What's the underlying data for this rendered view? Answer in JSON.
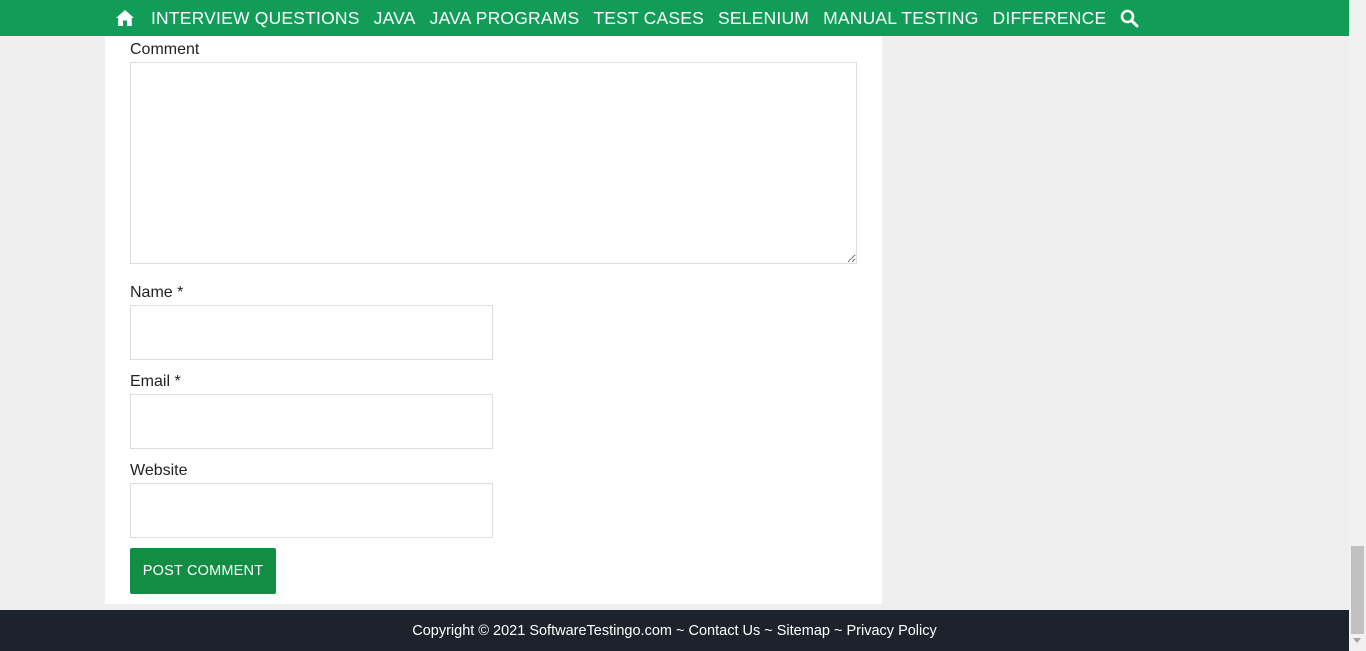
{
  "nav": {
    "items": [
      {
        "label": "INTERVIEW QUESTIONS"
      },
      {
        "label": "JAVA"
      },
      {
        "label": "JAVA PROGRAMS"
      },
      {
        "label": "TEST CASES"
      },
      {
        "label": "SELENIUM"
      },
      {
        "label": "MANUAL TESTING"
      },
      {
        "label": "DIFFERENCE"
      }
    ],
    "home_icon": "home-icon",
    "search_icon": "search-icon",
    "bg_color": "#119c57"
  },
  "form": {
    "comment_label": "Comment",
    "comment_value": "",
    "name_label": "Name *",
    "name_value": "",
    "email_label": "Email *",
    "email_value": "",
    "website_label": "Website",
    "website_value": "",
    "submit_label": "POST COMMENT",
    "submit_color": "#118e43"
  },
  "footer": {
    "copyright": "Copyright © 2021 SoftwareTestingo.com",
    "sep1": " ~ ",
    "contact": "Contact Us",
    "sep2": " ~ ",
    "sitemap": "Sitemap",
    "sep3": " ~ ",
    "privacy": "Privacy Policy",
    "bg_color": "#1c232c"
  }
}
